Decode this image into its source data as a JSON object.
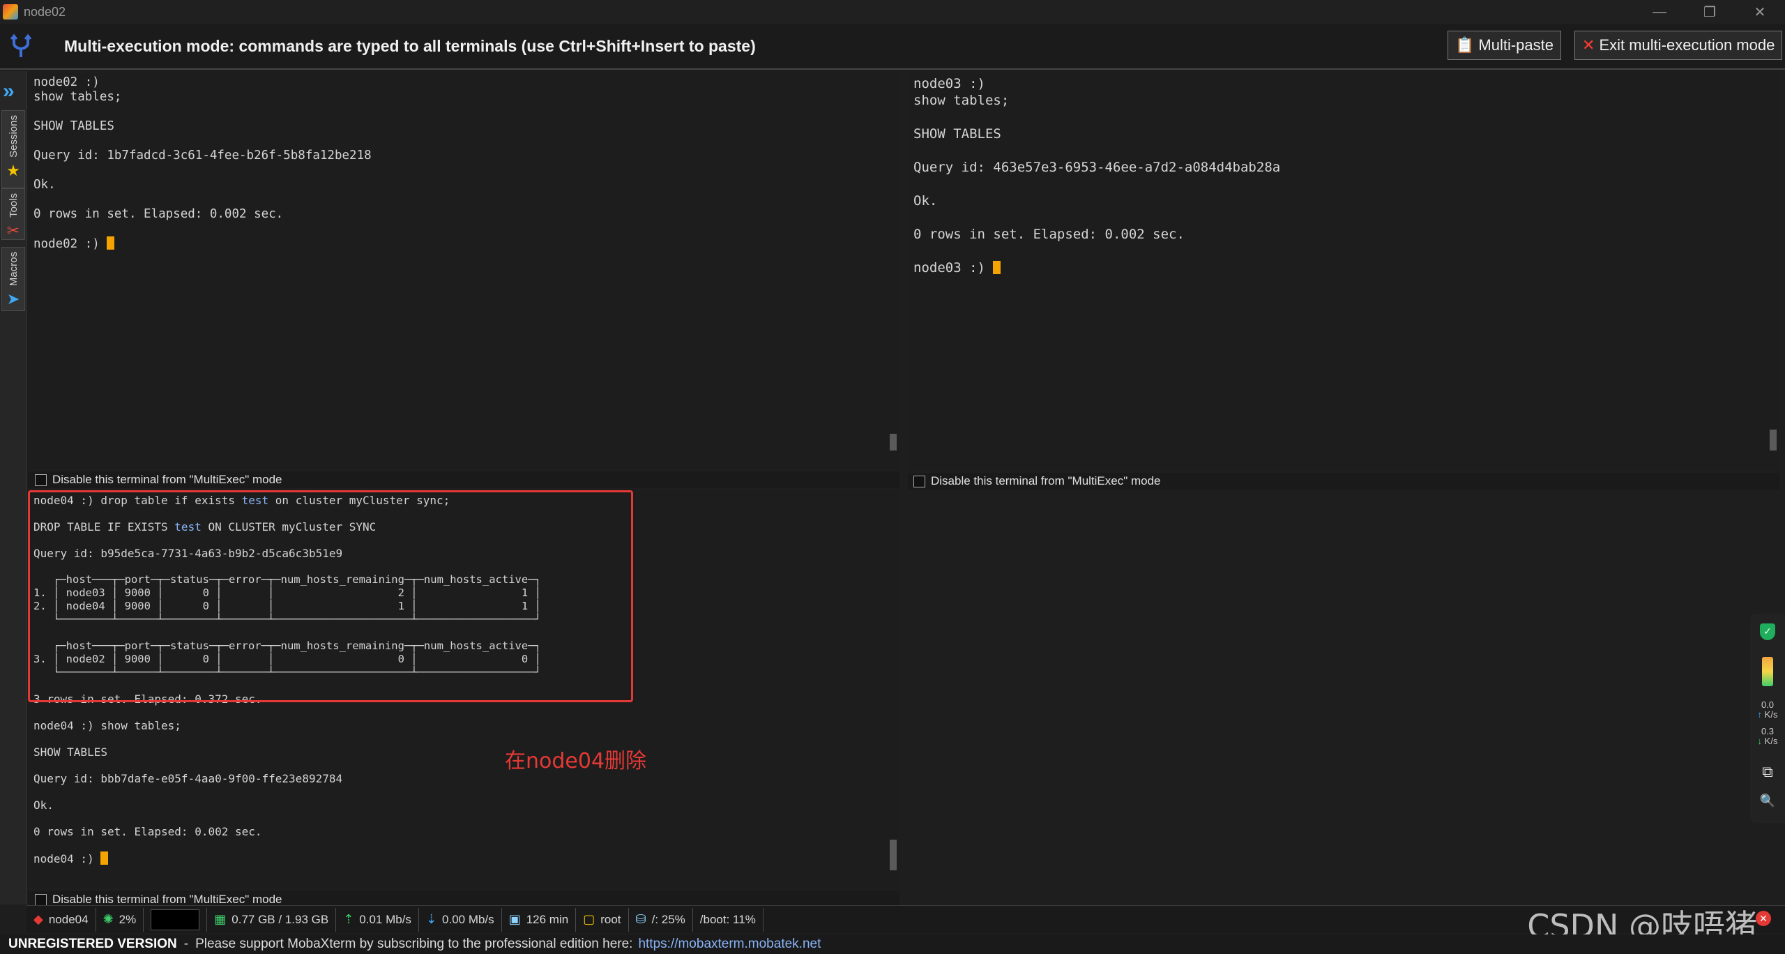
{
  "window": {
    "title": "node02",
    "minimize": "—",
    "restore": "❐",
    "close": "✕"
  },
  "banner": {
    "message": "Multi-execution mode: commands are typed to all terminals (use Ctrl+Shift+Insert to paste)",
    "multipaste_label": "Multi-paste",
    "exit_label": "Exit multi-execution mode"
  },
  "dock": {
    "tabs": [
      "Sessions",
      "Tools",
      "Macros"
    ]
  },
  "panes": {
    "node02": {
      "lines": [
        "node02 :)",
        "show tables;",
        "",
        "SHOW TABLES",
        "",
        "Query id: 1b7fadcd-3c61-4fee-b26f-5b8fa12be218",
        "",
        "Ok.",
        "",
        "0 rows in set. Elapsed: 0.002 sec.",
        ""
      ],
      "prompt": "node02 :) "
    },
    "node03": {
      "lines": [
        "node03 :)",
        "show tables;",
        "",
        "SHOW TABLES",
        "",
        "Query id: 463e57e3-6953-46ee-a7d2-a084d4bab28a",
        "",
        "Ok.",
        "",
        "0 rows in set. Elapsed: 0.002 sec.",
        ""
      ],
      "prompt": "node03 :) "
    },
    "node04": {
      "cmd1_prefix": "node04 :) drop table if exists ",
      "cmd1_test": "test",
      "cmd1_suffix": " on cluster myCluster sync;",
      "echo_prefix": "DROP TABLE IF EXISTS ",
      "echo_test": "test",
      "echo_suffix": " ON CLUSTER myCluster SYNC",
      "query_id1": "Query id: b95de5ca-7731-4a63-b9b2-d5ca6c3b51e9",
      "table1": [
        "   ┌─host───┬─port─┬─status─┬─error─┬─num_hosts_remaining─┬─num_hosts_active─┐",
        "1. │ node03 │ 9000 │      0 │       │                   2 │                1 │",
        "2. │ node04 │ 9000 │      0 │       │                   1 │                1 │",
        "   └────────┴──────┴────────┴───────┴─────────────────────┴──────────────────┘"
      ],
      "table2": [
        "   ┌─host───┬─port─┬─status─┬─error─┬─num_hosts_remaining─┬─num_hosts_active─┐",
        "3. │ node02 │ 9000 │      0 │       │                   0 │                0 │",
        "   └────────┴──────┴────────┴───────┴─────────────────────┴──────────────────┘"
      ],
      "rows_msg": "3 rows in set. Elapsed: 0.372 sec.",
      "cmd2": "node04 :) show tables;",
      "show_echo": "SHOW TABLES",
      "query_id2": "Query id: bbb7dafe-e05f-4aa0-9f00-ffe23e892784",
      "ok": "Ok.",
      "rows_msg2": "0 rows in set. Elapsed: 0.002 sec.",
      "prompt": "node04 :) "
    }
  },
  "disable_label": "Disable this terminal from \"MultiExec\" mode",
  "annotation": "在node04删除",
  "side": {
    "up_value": "0.0",
    "up_unit": "K/s",
    "down_value": "0.3",
    "down_unit": "K/s"
  },
  "status": {
    "host": "node04",
    "cpu": "2%",
    "memory": "0.77 GB / 1.93 GB",
    "upload": "0.01 Mb/s",
    "download": "0.00 Mb/s",
    "uptime": "126 min",
    "user": "root",
    "disk_root": "/: 25%",
    "disk_boot": "/boot: 11%"
  },
  "footer": {
    "unregistered": "UNREGISTERED VERSION",
    "sep": "-",
    "support": "Please support MobaXterm by subscribing to the professional edition here:",
    "link": "https://mobaxterm.mobatek.net"
  },
  "watermark": "CSDN @吱唔猪",
  "colors": {
    "cursor": "#f5a300",
    "accent": "#3fa9f5",
    "annotation": "#e53935"
  }
}
